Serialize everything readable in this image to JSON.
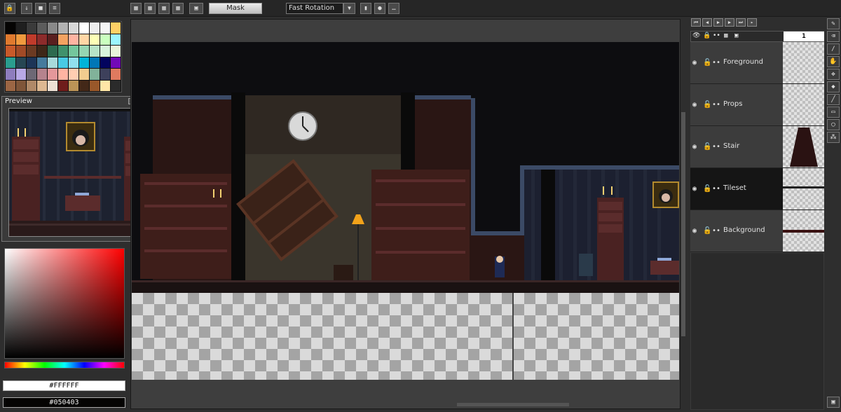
{
  "toolbar": {
    "mask_label": "Mask",
    "rotation_mode": "Fast Rotation",
    "icons": [
      "lock-icon",
      "arrow-down-icon",
      "folder-icon",
      "menu-icon",
      "grid1-icon",
      "grid2-icon",
      "grid3-icon",
      "grid4-icon",
      "image-icon",
      "frame-icon",
      "onion-icon",
      "more-icon"
    ]
  },
  "palette": {
    "colors": [
      "#050403",
      "#1f1f1f",
      "#3b3b3b",
      "#5c5c5c",
      "#8a8a8a",
      "#b3b3b3",
      "#d9d9d9",
      "#ffffff",
      "#eeeeee",
      "#f5f5f5",
      "#ffd166",
      "#e07a2e",
      "#f09a3e",
      "#c03b2b",
      "#8c2b2b",
      "#5a1f1f",
      "#f4a261",
      "#ffb4a2",
      "#ffd6a5",
      "#fdffb6",
      "#caffbf",
      "#9bf6ff",
      "#c85a2a",
      "#a14a26",
      "#6b3a22",
      "#3e2718",
      "#2d6a4f",
      "#40916c",
      "#74c69d",
      "#95d5b2",
      "#b7e4c7",
      "#d8f3dc",
      "#e9f5db",
      "#2a9d8f",
      "#264653",
      "#1d3557",
      "#457b9d",
      "#a8dadc",
      "#48cae4",
      "#90e0ef",
      "#00b4d8",
      "#0077b6",
      "#03045e",
      "#7209b7",
      "#8e7dbe",
      "#b8a9e6",
      "#6d6875",
      "#b5838d",
      "#e5989b",
      "#ffb4a2",
      "#ffcdb2",
      "#f2cc8f",
      "#81b29a",
      "#3d405b",
      "#e07a5f",
      "#9c6644",
      "#7f5539",
      "#b08968",
      "#ddb892",
      "#ede0d4",
      "#6f1d1b",
      "#bb9457",
      "#432818",
      "#99582a",
      "#ffe6a7",
      "#2b2b2b"
    ]
  },
  "preview": {
    "title": "Preview"
  },
  "color": {
    "primary_hex": "#FFFFFF",
    "secondary_hex": "#050403"
  },
  "animation": {
    "frame_number": "1"
  },
  "layers": [
    {
      "name": "Foreground",
      "selected": false
    },
    {
      "name": "Props",
      "selected": false
    },
    {
      "name": "Stair",
      "selected": false
    },
    {
      "name": "Tileset",
      "selected": true
    },
    {
      "name": "Background",
      "selected": false
    }
  ],
  "tools": [
    "pencil-icon",
    "eraser-icon",
    "brush-icon",
    "hand-icon",
    "move-icon",
    "fill-icon",
    "line-icon",
    "rect-icon",
    "ellipse-icon",
    "spray-icon"
  ]
}
